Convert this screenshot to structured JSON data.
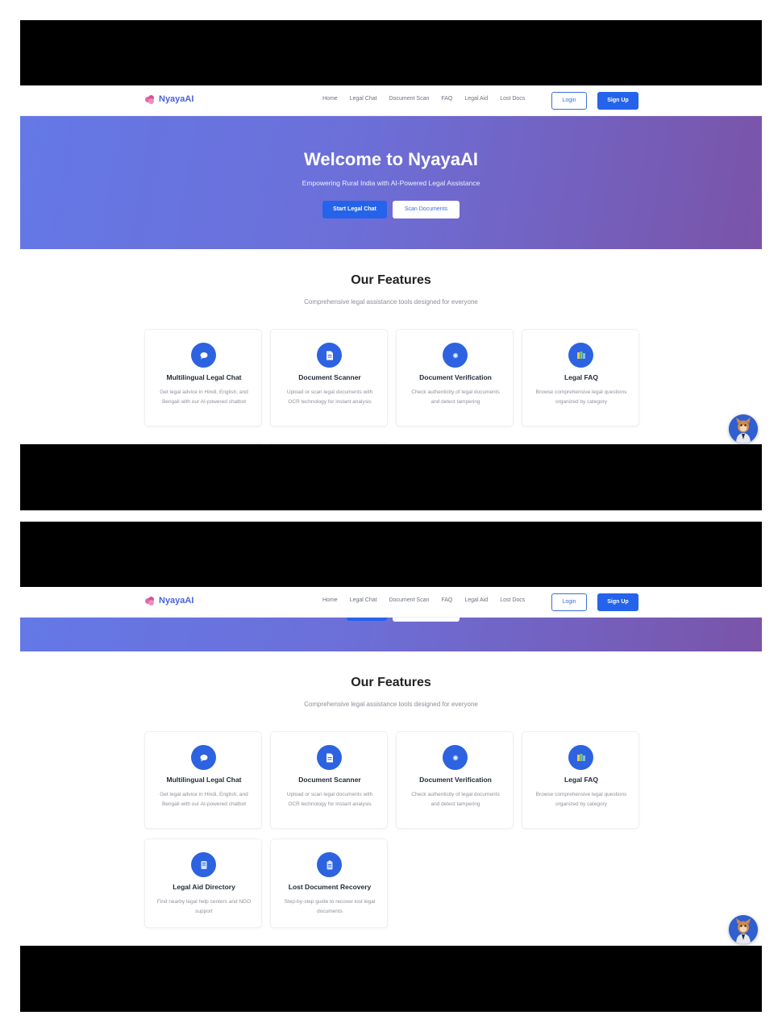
{
  "brand": {
    "name": "NyayaAI"
  },
  "nav": {
    "links": [
      "Home",
      "Legal Chat",
      "Document Scan",
      "FAQ",
      "Legal Aid",
      "Lost Docs"
    ],
    "login": "Login",
    "signup": "Sign Up"
  },
  "hero": {
    "title": "Welcome to NyayaAI",
    "subtitle": "Empowering Rural India with AI-Powered Legal Assistance",
    "primary_button": "Start Legal Chat",
    "secondary_button": "Scan Documents"
  },
  "features": {
    "title": "Our Features",
    "subtitle": "Comprehensive legal assistance tools designed for everyone",
    "cards": [
      {
        "title": "Multilingual Legal Chat",
        "desc": "Get legal advice in Hindi, English, and Bengali with our AI-powered chatbot",
        "icon": "chat-bubble-icon"
      },
      {
        "title": "Document Scanner",
        "desc": "Upload or scan legal documents with OCR technology for instant analysis",
        "icon": "document-icon"
      },
      {
        "title": "Document Verification",
        "desc": "Check authenticity of legal documents and detect tampering",
        "icon": "verification-icon"
      },
      {
        "title": "Legal FAQ",
        "desc": "Browse comprehensive legal questions organized by category",
        "icon": "books-icon"
      },
      {
        "title": "Legal Aid Directory",
        "desc": "Find nearby legal help centers and NGO support",
        "icon": "directory-icon"
      },
      {
        "title": "Lost Document Recovery",
        "desc": "Step-by-step guide to recover lost legal documents",
        "icon": "clipboard-icon"
      }
    ]
  },
  "colors": {
    "primary": "#2563eb",
    "brand": "#4a63d9",
    "hero_start": "#6478e6",
    "hero_end": "#7a54a8"
  },
  "assistant": {
    "icon": "assistant-avatar-icon"
  }
}
